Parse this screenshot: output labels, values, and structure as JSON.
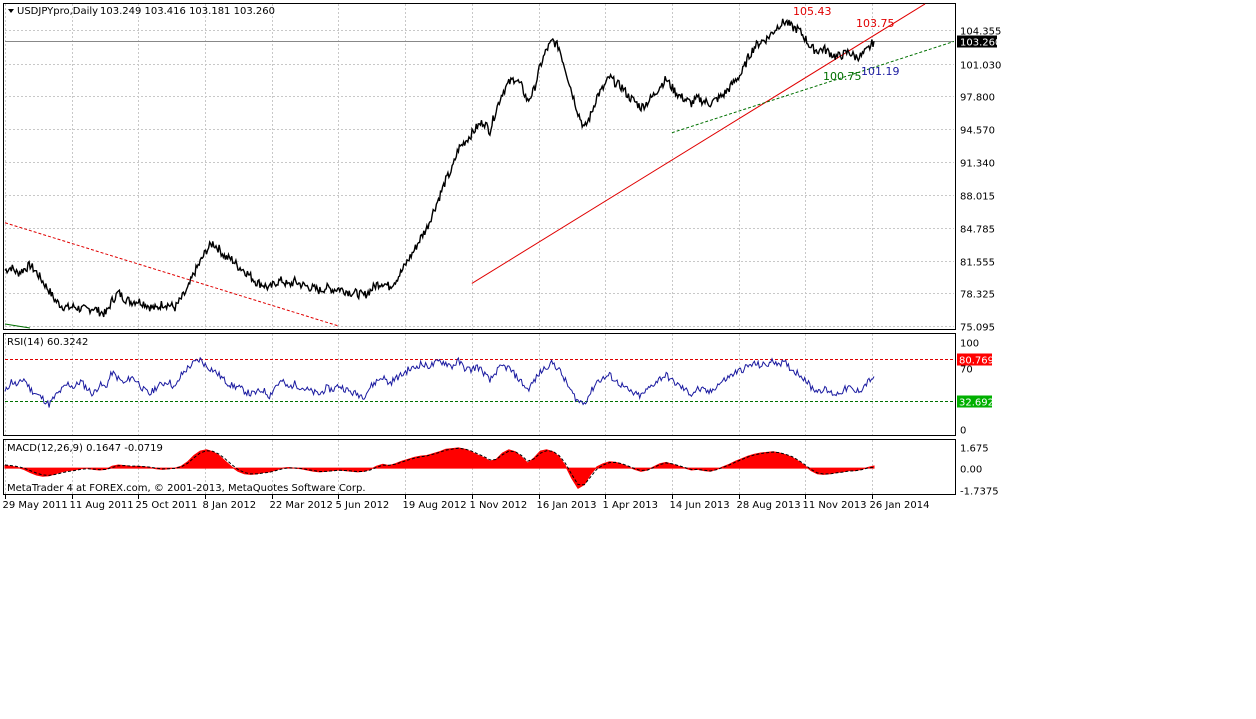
{
  "window": {
    "title": "USDJPYpro,Daily",
    "ohlc": "103.249 103.416 103.181 103.260",
    "watermark": "MetaTrader 4 at FOREX.com, © 2001-2013, MetaQuotes Software Corp."
  },
  "colors": {
    "price": "#000000",
    "uptrend": "#e00000",
    "support": "#007000",
    "rsi": "#1a1aa0",
    "macd_hist": "#ff0000",
    "grid": "#c8c8c8",
    "last_price_bg": "#000000",
    "level_high_bg": "#ff0000",
    "level_low_bg": "#00b000"
  },
  "chart_data": [
    {
      "type": "line",
      "panel": "price",
      "title": "USDJPYpro,Daily",
      "y_ticks": [
        "104.355",
        "101.030",
        "97.800",
        "94.570",
        "91.340",
        "88.015",
        "84.785",
        "81.555",
        "78.325",
        "75.095"
      ],
      "ylim": [
        75.095,
        104.355
      ],
      "x_ticks": [
        "29 May 2011",
        "11 Aug 2011",
        "25 Oct 2011",
        "8 Jan 2012",
        "22 Mar 2012",
        "5 Jun 2012",
        "19 Aug 2012",
        "1 Nov 2012",
        "16 Jan 2013",
        "1 Apr 2013",
        "14 Jun 2013",
        "28 Aug 2013",
        "11 Nov 2013",
        "26 Jan 2014"
      ],
      "last_price": "103.260",
      "annotations": [
        "105.43",
        "103.75",
        "100.75",
        "101.19"
      ],
      "series": [
        {
          "values": [
            80.6,
            80.9,
            80.3,
            80.7,
            81.1,
            80.4,
            79.5,
            78.6,
            77.6,
            77.1,
            76.9,
            77.0,
            76.8,
            76.7,
            76.9,
            76.5,
            76.3,
            77.6,
            78.4,
            77.8,
            77.5,
            77.6,
            77.4,
            77.0,
            76.8,
            77.3,
            77.2,
            76.9,
            77.8,
            78.7,
            80.3,
            81.4,
            82.6,
            83.3,
            82.7,
            81.9,
            81.7,
            81.0,
            80.6,
            80.0,
            79.4,
            79.2,
            78.8,
            79.4,
            79.6,
            79.1,
            79.5,
            79.2,
            79.0,
            78.8,
            78.6,
            78.9,
            78.7,
            78.8,
            78.6,
            78.4,
            78.3,
            78.1,
            78.6,
            79.2,
            79.4,
            79.0,
            79.6,
            80.5,
            81.6,
            82.6,
            83.8,
            84.8,
            86.4,
            87.9,
            89.5,
            90.6,
            92.6,
            93.3,
            94.0,
            94.8,
            95.3,
            94.4,
            96.5,
            98.2,
            99.1,
            99.6,
            98.8,
            97.3,
            98.4,
            100.8,
            102.4,
            103.3,
            102.6,
            100.5,
            98.3,
            96.2,
            94.6,
            95.9,
            97.8,
            98.6,
            99.7,
            99.1,
            98.7,
            97.8,
            97.3,
            96.7,
            97.2,
            97.9,
            98.8,
            99.5,
            98.6,
            97.9,
            97.5,
            97.1,
            97.6,
            97.3,
            97.1,
            97.5,
            97.9,
            98.6,
            99.4,
            100.1,
            101.6,
            102.7,
            103.2,
            103.5,
            104.2,
            104.9,
            105.2,
            104.6,
            104.4,
            103.6,
            102.6,
            102.3,
            102.5,
            102.1,
            101.7,
            101.9,
            102.2,
            101.7,
            101.8,
            102.4,
            103.26
          ]
        }
      ],
      "trendlines": [
        {
          "name": "uptrend",
          "from": {
            "x": "1 Nov 2012",
            "y": 79.3
          },
          "to": {
            "x": "26 Jan 2014",
            "y": 103.7
          }
        },
        {
          "name": "support",
          "from": {
            "x": "14 Jun 2013",
            "y": 94.2
          },
          "to": {
            "x": "26 Jan 2014",
            "y": 100.6
          }
        },
        {
          "name": "downtrend",
          "from": {
            "x": "29 May 2011",
            "y": 85.3
          },
          "to": {
            "x": "5 Jun 2012",
            "y": 75.1
          }
        }
      ]
    },
    {
      "type": "line",
      "panel": "rsi",
      "title": "RSI(14) 60.3242",
      "y_ticks": [
        "100",
        "70",
        "0"
      ],
      "ylim": [
        0,
        100
      ],
      "levels": [
        "80.769",
        "32.692"
      ],
      "series": [
        {
          "values": [
            42,
            55,
            50,
            58,
            46,
            40,
            35,
            28,
            38,
            45,
            52,
            48,
            55,
            47,
            40,
            51,
            48,
            65,
            58,
            52,
            60,
            55,
            45,
            40,
            48,
            52,
            55,
            47,
            62,
            70,
            76,
            80,
            72,
            68,
            62,
            55,
            50,
            48,
            44,
            40,
            42,
            45,
            38,
            50,
            55,
            47,
            52,
            48,
            45,
            42,
            40,
            47,
            45,
            50,
            46,
            42,
            40,
            38,
            48,
            55,
            60,
            52,
            58,
            62,
            68,
            70,
            75,
            72,
            74,
            78,
            76,
            72,
            78,
            70,
            68,
            72,
            65,
            55,
            66,
            72,
            70,
            62,
            54,
            45,
            55,
            65,
            72,
            76,
            68,
            55,
            42,
            32,
            30,
            42,
            55,
            58,
            62,
            55,
            50,
            44,
            40,
            38,
            45,
            52,
            58,
            62,
            55,
            50,
            45,
            40,
            46,
            44,
            42,
            50,
            55,
            60,
            65,
            68,
            72,
            75,
            73,
            74,
            78,
            76,
            75,
            68,
            64,
            58,
            48,
            44,
            46,
            42,
            40,
            44,
            48,
            42,
            46,
            54,
            60.32
          ]
        }
      ]
    },
    {
      "type": "area",
      "panel": "macd",
      "title": "MACD(12,26,9) 0.1647 -0.0719",
      "y_ticks": [
        "1.675",
        "0.00",
        "-1.7375"
      ],
      "ylim": [
        -1.7375,
        1.675
      ],
      "series": [
        {
          "name": "MACD",
          "values": [
            0.2,
            0.15,
            0.05,
            -0.1,
            -0.35,
            -0.55,
            -0.65,
            -0.6,
            -0.45,
            -0.3,
            -0.2,
            -0.15,
            -0.05,
            0.0,
            -0.1,
            -0.15,
            -0.1,
            0.15,
            0.25,
            0.2,
            0.12,
            0.15,
            0.1,
            0.05,
            -0.05,
            -0.1,
            -0.05,
            0.0,
            0.15,
            0.5,
            1.0,
            1.35,
            1.45,
            1.3,
            1.0,
            0.55,
            0.1,
            -0.25,
            -0.45,
            -0.5,
            -0.45,
            -0.35,
            -0.3,
            -0.15,
            0.0,
            0.05,
            0.0,
            -0.05,
            -0.15,
            -0.25,
            -0.3,
            -0.25,
            -0.2,
            -0.15,
            -0.2,
            -0.25,
            -0.3,
            -0.25,
            -0.1,
            0.15,
            0.3,
            0.2,
            0.35,
            0.55,
            0.7,
            0.85,
            0.95,
            1.0,
            1.15,
            1.3,
            1.5,
            1.55,
            1.6,
            1.5,
            1.3,
            1.05,
            0.85,
            0.55,
            0.7,
            1.2,
            1.45,
            1.3,
            0.9,
            0.4,
            0.8,
            1.35,
            1.45,
            1.3,
            0.9,
            0.2,
            -0.8,
            -1.6,
            -1.3,
            -0.5,
            0.1,
            0.35,
            0.5,
            0.45,
            0.3,
            0.1,
            -0.1,
            -0.25,
            -0.15,
            0.1,
            0.35,
            0.45,
            0.3,
            0.15,
            0.0,
            -0.15,
            -0.1,
            -0.2,
            -0.25,
            -0.1,
            0.1,
            0.3,
            0.55,
            0.75,
            0.95,
            1.1,
            1.2,
            1.25,
            1.3,
            1.2,
            1.05,
            0.85,
            0.55,
            0.2,
            -0.2,
            -0.45,
            -0.5,
            -0.45,
            -0.35,
            -0.3,
            -0.2,
            -0.2,
            -0.1,
            0.05,
            0.1647
          ]
        },
        {
          "name": "Signal",
          "values": [
            0.25,
            0.2,
            0.12,
            0.0,
            -0.2,
            -0.4,
            -0.55,
            -0.58,
            -0.5,
            -0.38,
            -0.27,
            -0.2,
            -0.1,
            -0.05,
            -0.08,
            -0.12,
            -0.11,
            0.05,
            0.18,
            0.2,
            0.16,
            0.15,
            0.12,
            0.08,
            0.0,
            -0.06,
            -0.05,
            -0.02,
            0.1,
            0.38,
            0.82,
            1.2,
            1.38,
            1.33,
            1.1,
            0.72,
            0.28,
            -0.1,
            -0.35,
            -0.46,
            -0.46,
            -0.39,
            -0.33,
            -0.2,
            -0.06,
            0.02,
            0.01,
            -0.03,
            -0.11,
            -0.2,
            -0.27,
            -0.26,
            -0.22,
            -0.17,
            -0.19,
            -0.23,
            -0.28,
            -0.26,
            -0.15,
            0.06,
            0.24,
            0.22,
            0.31,
            0.48,
            0.64,
            0.79,
            0.9,
            0.97,
            1.1,
            1.25,
            1.43,
            1.51,
            1.57,
            1.52,
            1.37,
            1.14,
            0.93,
            0.65,
            0.68,
            1.06,
            1.35,
            1.31,
            1.01,
            0.55,
            0.74,
            1.18,
            1.38,
            1.33,
            1.0,
            0.38,
            -0.5,
            -1.3,
            -1.32,
            -0.7,
            -0.08,
            0.25,
            0.44,
            0.45,
            0.34,
            0.16,
            -0.04,
            -0.2,
            -0.16,
            0.04,
            0.28,
            0.41,
            0.33,
            0.19,
            0.04,
            -0.11,
            -0.1,
            -0.17,
            -0.23,
            -0.13,
            0.06,
            0.25,
            0.48,
            0.68,
            0.89,
            1.05,
            1.16,
            1.22,
            1.28,
            1.22,
            1.09,
            0.91,
            0.63,
            0.29,
            -0.1,
            -0.38,
            -0.47,
            -0.46,
            -0.38,
            -0.32,
            -0.23,
            -0.21,
            -0.13,
            0.01,
            0.0719
          ]
        }
      ]
    }
  ]
}
